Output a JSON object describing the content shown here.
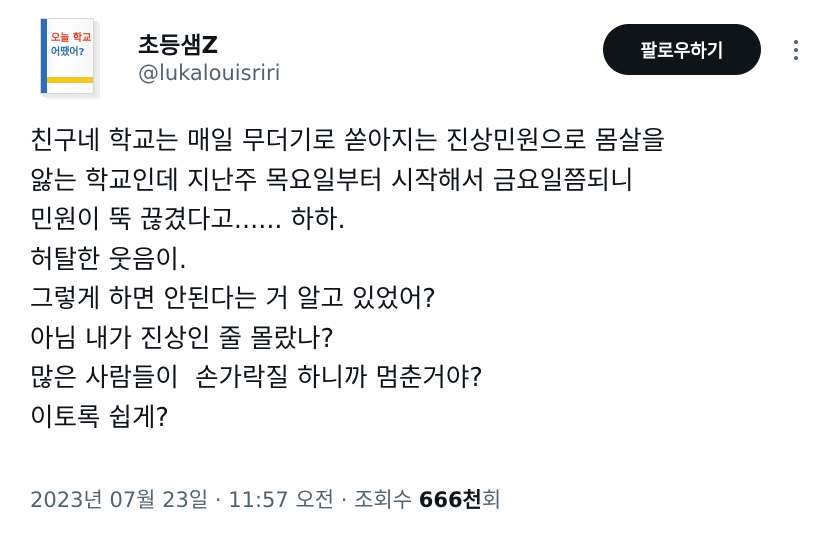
{
  "profile": {
    "avatar_book_title_line1": "오늘 학교",
    "avatar_book_title_line2": "어땠어?",
    "display_name": "초등샘Z",
    "handle": "@lukalouisriri"
  },
  "actions": {
    "follow_label": "팔로우하기",
    "more_icon": "more-vertical-icon"
  },
  "tweet": {
    "lines": [
      "친구네 학교는 매일 무더기로 쏟아지는 진상민원으로 몸살을",
      "앓는 학교인데 지난주 목요일부터 시작해서 금요일쯤되니",
      "민원이 뚝 끊겼다고...... 하하.",
      "허탈한 웃음이.",
      "그렇게 하면 안된다는 거 알고 있었어?",
      "아님 내가 진상인 줄 몰랐나?",
      "많은 사람들이  손가락질 하니까 멈춘거야?",
      "이토록 쉽게?"
    ]
  },
  "meta": {
    "timestamp": "2023년 07월 23일 · 11:57 오전 · 조회수 ",
    "views_count": "666천",
    "views_suffix": "회"
  },
  "colors": {
    "text_primary": "#0f1419",
    "text_secondary": "#536471",
    "button_bg": "#0f1419",
    "button_text": "#ffffff"
  }
}
